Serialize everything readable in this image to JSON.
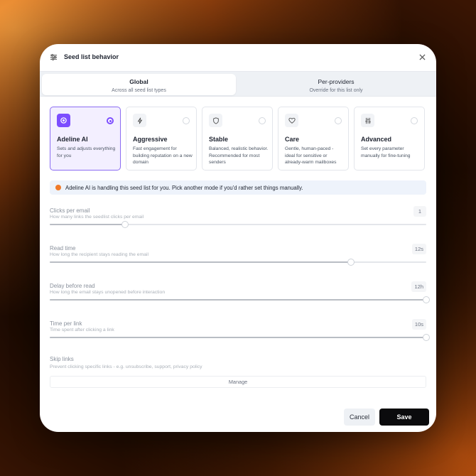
{
  "header": {
    "icon": "sliders-icon",
    "title": "Seed list behavior",
    "close_icon": "close-icon"
  },
  "tabs": [
    {
      "label": "Global",
      "sublabel": "Across all seed list types",
      "active": true
    },
    {
      "label": "Per-providers",
      "sublabel": "Override for this list only",
      "active": false
    }
  ],
  "modes": [
    {
      "name": "Adeline AI",
      "description": "Sets and adjusts everything for you",
      "icon": "sparkle-icon",
      "selected": true
    },
    {
      "name": "Aggressive",
      "description": "Fast engagement for building reputation on a new domain",
      "icon": "lightning-icon",
      "selected": false
    },
    {
      "name": "Stable",
      "description": "Balanced, realistic behavior. Recommended for most senders",
      "icon": "shield-icon",
      "selected": false
    },
    {
      "name": "Care",
      "description": "Gentle, human-paced - ideal for sensitive or already-warm mailboxes",
      "icon": "heart-icon",
      "selected": false
    },
    {
      "name": "Advanced",
      "description": "Set every parameter manually for fine-tuning",
      "icon": "equalizer-icon",
      "selected": false
    }
  ],
  "banner": {
    "icon": "adeline-dot-icon",
    "text": "Adeline AI is handling this seed list for you. Pick another mode if you'd rather set things manually."
  },
  "settings": [
    {
      "label": "Clicks per email",
      "description": "How many links the seedlist clicks per email",
      "value": "1",
      "fraction": 0.2
    },
    {
      "label": "Read time",
      "description": "How long the recipient stays reading the email",
      "value": "12s",
      "fraction": 0.8
    },
    {
      "label": "Delay before read",
      "description": "How long the email stays unopened before interaction",
      "value": "12h",
      "fraction": 1.0
    },
    {
      "label": "Time per link",
      "description": "Time spent after clicking a link",
      "value": "10s",
      "fraction": 1.0
    }
  ],
  "skip_links": {
    "label": "Skip links",
    "description": "Prevent clicking specific links - e.g. unsubscribe, support, privacy policy",
    "manage_label": "Manage"
  },
  "footer": {
    "cancel_label": "Cancel",
    "save_label": "Save"
  },
  "colors": {
    "accent": "#7c4dff",
    "banner_dot": "#f07a2a",
    "save_bg": "#0b0b0d"
  }
}
